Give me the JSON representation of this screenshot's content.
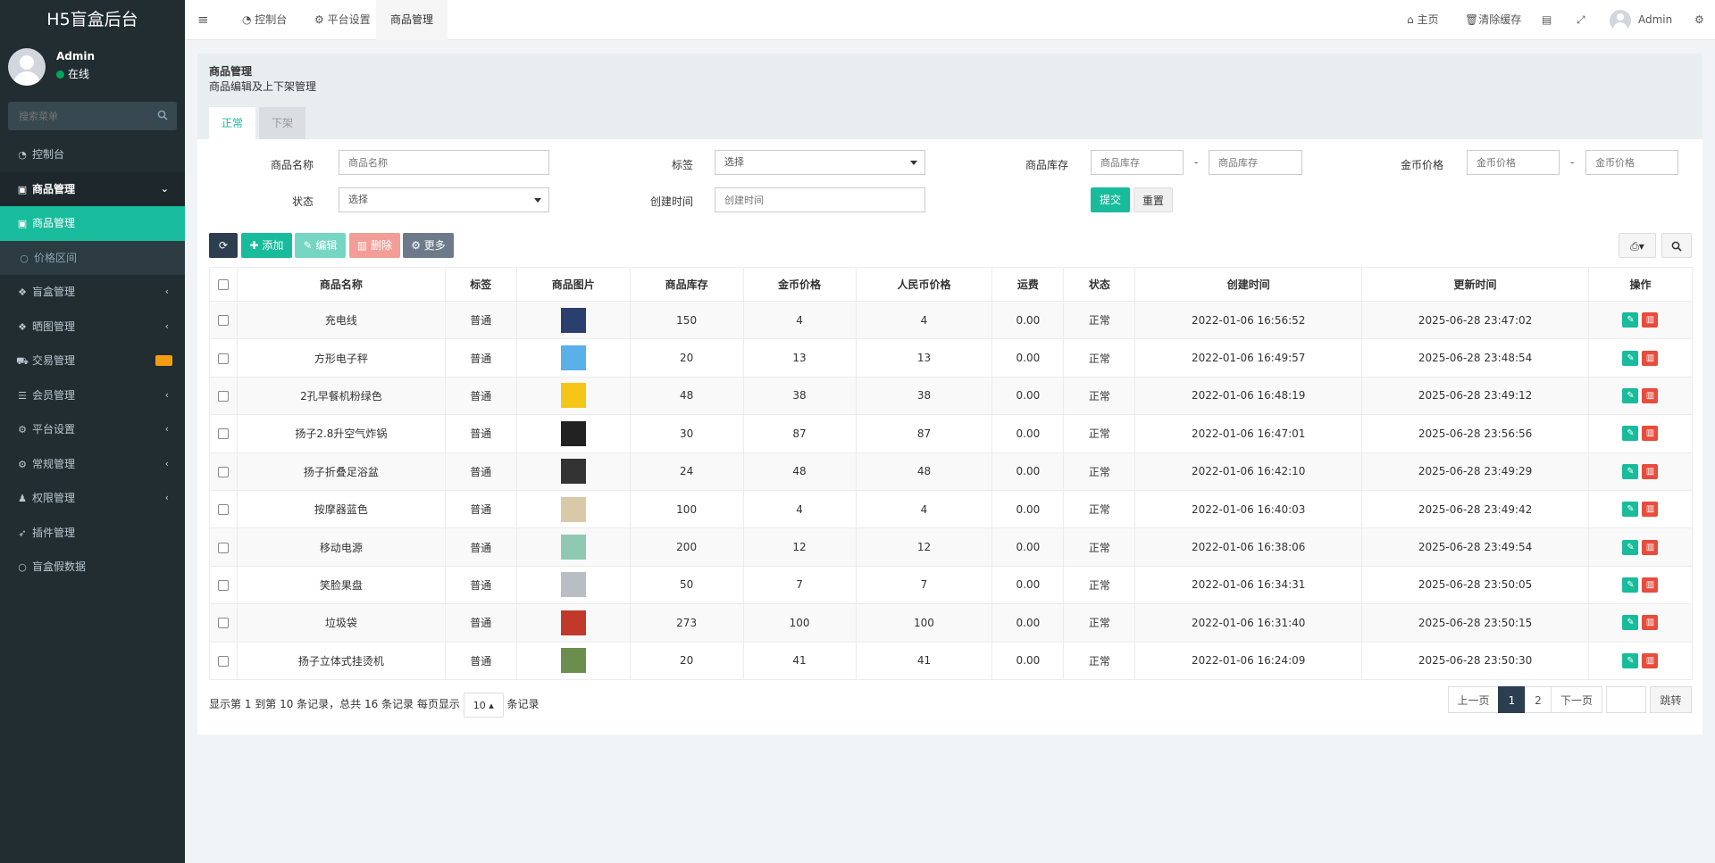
{
  "sidebar": {
    "logo": "H5盲盒后台",
    "user_name": "Admin",
    "user_status": "在线",
    "search_placeholder": "搜索菜单",
    "items": [
      {
        "label": "控制台",
        "icon": "dashboard-icon",
        "glyph": "◔"
      },
      {
        "label": "商品管理",
        "icon": "shopping-bag-icon",
        "glyph": "▣",
        "chev": "⌄"
      },
      {
        "label": "商品管理",
        "icon": "shopping-bag-icon",
        "glyph": "▣"
      },
      {
        "label": "价格区间",
        "icon": "circle-icon",
        "glyph": "○"
      },
      {
        "label": "盲盒管理",
        "icon": "dropbox-icon",
        "glyph": "❖",
        "chev": "‹"
      },
      {
        "label": "晒图管理",
        "icon": "dropbox-icon",
        "glyph": "❖",
        "chev": "‹"
      },
      {
        "label": "交易管理",
        "icon": "cart-icon",
        "glyph": "⛟"
      },
      {
        "label": "会员管理",
        "icon": "list-icon",
        "glyph": "☰",
        "chev": "‹"
      },
      {
        "label": "平台设置",
        "icon": "cogs-icon",
        "glyph": "⚙",
        "chev": "‹"
      },
      {
        "label": "常规管理",
        "icon": "cogs-icon",
        "glyph": "⚙",
        "chev": "‹"
      },
      {
        "label": "权限管理",
        "icon": "users-icon",
        "glyph": "♟",
        "chev": "‹"
      },
      {
        "label": "插件管理",
        "icon": "rocket-icon",
        "glyph": "➶"
      },
      {
        "label": "盲盒假数据",
        "icon": "circle-icon",
        "glyph": "○"
      }
    ]
  },
  "header": {
    "menu_toggle": "≡",
    "tabs": [
      "控制台",
      "平台设置",
      "商品管理"
    ],
    "home": "主页",
    "clear_cache": "清除缓存",
    "admin": "Admin"
  },
  "panel": {
    "title": "商品管理",
    "subtitle": "商品编辑及上下架管理",
    "tabs": [
      "正常",
      "下架"
    ]
  },
  "filter": {
    "name_label": "商品名称",
    "name_placeholder": "商品名称",
    "tag_label": "标签",
    "tag_value": "选择",
    "stock_label": "商品库存",
    "stock_min_placeholder": "商品库存",
    "stock_max_placeholder": "商品库存",
    "price_label": "金币价格",
    "price_min_placeholder": "金币价格",
    "price_max_placeholder": "金币价格",
    "status_label": "状态",
    "status_value": "选择",
    "created_label": "创建时间",
    "created_placeholder": "创建时间",
    "dash": "-",
    "submit": "提交",
    "reset": "重置"
  },
  "toolbar": {
    "add": "添加",
    "edit": "编辑",
    "delete": "删除",
    "more": "更多"
  },
  "table": {
    "columns": [
      "商品名称",
      "标签",
      "商品图片",
      "商品库存",
      "金币价格",
      "人民币价格",
      "运费",
      "状态",
      "创建时间",
      "更新时间",
      "操作"
    ],
    "rows": [
      {
        "name": "充电线",
        "tag": "普通",
        "stock": "150",
        "gold": "4",
        "rmb": "4",
        "freight": "0.00",
        "status": "正常",
        "created": "2022-01-06 16:56:52",
        "updated": "2025-06-28 23:47:02",
        "thumb": "#2a3f6e"
      },
      {
        "name": "方形电子秤",
        "tag": "普通",
        "stock": "20",
        "gold": "13",
        "rmb": "13",
        "freight": "0.00",
        "status": "正常",
        "created": "2022-01-06 16:49:57",
        "updated": "2025-06-28 23:48:54",
        "thumb": "#5ab0e8"
      },
      {
        "name": "2孔早餐机粉绿色",
        "tag": "普通",
        "stock": "48",
        "gold": "38",
        "rmb": "38",
        "freight": "0.00",
        "status": "正常",
        "created": "2022-01-06 16:48:19",
        "updated": "2025-06-28 23:49:12",
        "thumb": "#f5c518"
      },
      {
        "name": "扬子2.8升空气炸锅",
        "tag": "普通",
        "stock": "30",
        "gold": "87",
        "rmb": "87",
        "freight": "0.00",
        "status": "正常",
        "created": "2022-01-06 16:47:01",
        "updated": "2025-06-28 23:56:56",
        "thumb": "#222222"
      },
      {
        "name": "扬子折叠足浴盆",
        "tag": "普通",
        "stock": "24",
        "gold": "48",
        "rmb": "48",
        "freight": "0.00",
        "status": "正常",
        "created": "2022-01-06 16:42:10",
        "updated": "2025-06-28 23:49:29",
        "thumb": "#333333"
      },
      {
        "name": "按摩器蓝色",
        "tag": "普通",
        "stock": "100",
        "gold": "4",
        "rmb": "4",
        "freight": "0.00",
        "status": "正常",
        "created": "2022-01-06 16:40:03",
        "updated": "2025-06-28 23:49:42",
        "thumb": "#d9c9a8"
      },
      {
        "name": "移动电源",
        "tag": "普通",
        "stock": "200",
        "gold": "12",
        "rmb": "12",
        "freight": "0.00",
        "status": "正常",
        "created": "2022-01-06 16:38:06",
        "updated": "2025-06-28 23:49:54",
        "thumb": "#8fc9b4"
      },
      {
        "name": "笑脸果盘",
        "tag": "普通",
        "stock": "50",
        "gold": "7",
        "rmb": "7",
        "freight": "0.00",
        "status": "正常",
        "created": "2022-01-06 16:34:31",
        "updated": "2025-06-28 23:50:05",
        "thumb": "#b9bec4"
      },
      {
        "name": "垃圾袋",
        "tag": "普通",
        "stock": "273",
        "gold": "100",
        "rmb": "100",
        "freight": "0.00",
        "status": "正常",
        "created": "2022-01-06 16:31:40",
        "updated": "2025-06-28 23:50:15",
        "thumb": "#c0392b"
      },
      {
        "name": "扬子立体式挂烫机",
        "tag": "普通",
        "stock": "20",
        "gold": "41",
        "rmb": "41",
        "freight": "0.00",
        "status": "正常",
        "created": "2022-01-06 16:24:09",
        "updated": "2025-06-28 23:50:30",
        "thumb": "#6b8e4e"
      }
    ]
  },
  "footer": {
    "info_prefix": "显示第 1 到第 10 条记录，总共 16 条记录 每页显示",
    "page_size": "10",
    "info_suffix": "条记录",
    "prev": "上一页",
    "pages": [
      "1",
      "2"
    ],
    "next": "下一页",
    "jump": "跳转"
  },
  "colors": {
    "accent": "#18bc9c",
    "sidebar": "#222d32",
    "danger": "#e74c3c",
    "dark": "#2c3e50"
  }
}
